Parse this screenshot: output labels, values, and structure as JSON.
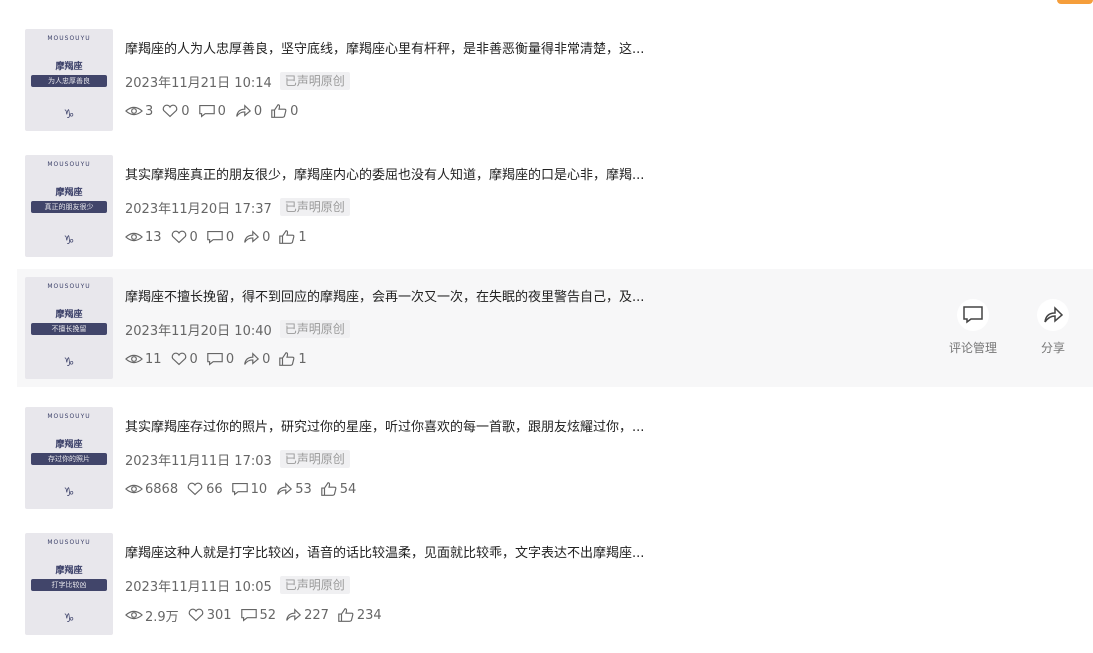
{
  "original_tag": "已声明原创",
  "thumbnail": {
    "brand": "MOUSOUYU",
    "sign": "摩羯座",
    "symbol": "♑"
  },
  "hover_actions": {
    "comment": "评论管理",
    "share": "分享"
  },
  "posts": [
    {
      "title": "摩羯座的人为人忠厚善良，坚守底线，摩羯座心里有杆秤，是非善恶衡量得非常清楚，这...",
      "date": "2023年11月21日 10:14",
      "banner": "为人忠厚善良",
      "stats": {
        "views": "3",
        "likes": "0",
        "comments": "0",
        "shares": "0",
        "thumbs": "0"
      }
    },
    {
      "title": "其实摩羯座真正的朋友很少，摩羯座内心的委屈也没有人知道，摩羯座的口是心非，摩羯...",
      "date": "2023年11月20日 17:37",
      "banner": "真正的朋友很少",
      "stats": {
        "views": "13",
        "likes": "0",
        "comments": "0",
        "shares": "0",
        "thumbs": "1"
      }
    },
    {
      "title": "摩羯座不擅长挽留，得不到回应的摩羯座，会再一次又一次，在失眠的夜里警告自己，及...",
      "date": "2023年11月20日 10:40",
      "banner": "不擅长挽留",
      "stats": {
        "views": "11",
        "likes": "0",
        "comments": "0",
        "shares": "0",
        "thumbs": "1"
      }
    },
    {
      "title": "其实摩羯座存过你的照片，研究过你的星座，听过你喜欢的每一首歌，跟朋友炫耀过你，...",
      "date": "2023年11月11日 17:03",
      "banner": "存过你的照片",
      "stats": {
        "views": "6868",
        "likes": "66",
        "comments": "10",
        "shares": "53",
        "thumbs": "54"
      }
    },
    {
      "title": "摩羯座这种人就是打字比较凶，语音的话比较温柔，见面就比较乖，文字表达不出摩羯座...",
      "date": "2023年11月11日 10:05",
      "banner": "打字比较凶",
      "stats": {
        "views": "2.9万",
        "likes": "301",
        "comments": "52",
        "shares": "227",
        "thumbs": "234"
      }
    }
  ]
}
